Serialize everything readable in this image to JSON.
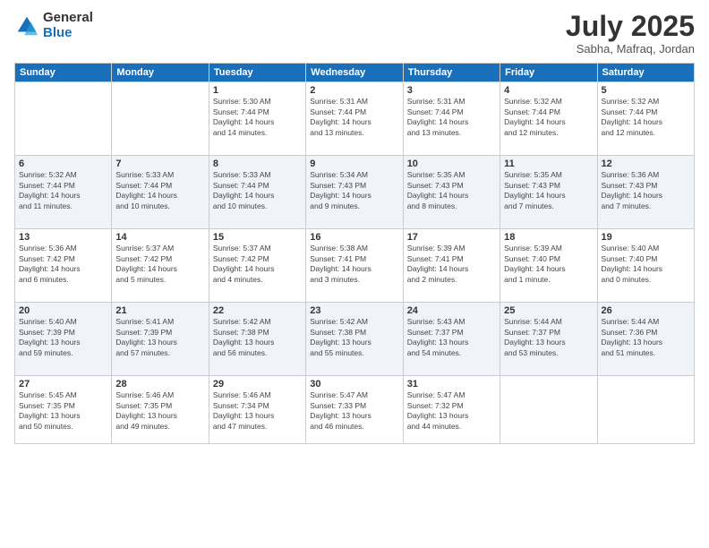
{
  "logo": {
    "general": "General",
    "blue": "Blue"
  },
  "title": "July 2025",
  "subtitle": "Sabha, Mafraq, Jordan",
  "days_of_week": [
    "Sunday",
    "Monday",
    "Tuesday",
    "Wednesday",
    "Thursday",
    "Friday",
    "Saturday"
  ],
  "weeks": [
    [
      {
        "num": "",
        "info": ""
      },
      {
        "num": "",
        "info": ""
      },
      {
        "num": "1",
        "info": "Sunrise: 5:30 AM\nSunset: 7:44 PM\nDaylight: 14 hours\nand 14 minutes."
      },
      {
        "num": "2",
        "info": "Sunrise: 5:31 AM\nSunset: 7:44 PM\nDaylight: 14 hours\nand 13 minutes."
      },
      {
        "num": "3",
        "info": "Sunrise: 5:31 AM\nSunset: 7:44 PM\nDaylight: 14 hours\nand 13 minutes."
      },
      {
        "num": "4",
        "info": "Sunrise: 5:32 AM\nSunset: 7:44 PM\nDaylight: 14 hours\nand 12 minutes."
      },
      {
        "num": "5",
        "info": "Sunrise: 5:32 AM\nSunset: 7:44 PM\nDaylight: 14 hours\nand 12 minutes."
      }
    ],
    [
      {
        "num": "6",
        "info": "Sunrise: 5:32 AM\nSunset: 7:44 PM\nDaylight: 14 hours\nand 11 minutes."
      },
      {
        "num": "7",
        "info": "Sunrise: 5:33 AM\nSunset: 7:44 PM\nDaylight: 14 hours\nand 10 minutes."
      },
      {
        "num": "8",
        "info": "Sunrise: 5:33 AM\nSunset: 7:44 PM\nDaylight: 14 hours\nand 10 minutes."
      },
      {
        "num": "9",
        "info": "Sunrise: 5:34 AM\nSunset: 7:43 PM\nDaylight: 14 hours\nand 9 minutes."
      },
      {
        "num": "10",
        "info": "Sunrise: 5:35 AM\nSunset: 7:43 PM\nDaylight: 14 hours\nand 8 minutes."
      },
      {
        "num": "11",
        "info": "Sunrise: 5:35 AM\nSunset: 7:43 PM\nDaylight: 14 hours\nand 7 minutes."
      },
      {
        "num": "12",
        "info": "Sunrise: 5:36 AM\nSunset: 7:43 PM\nDaylight: 14 hours\nand 7 minutes."
      }
    ],
    [
      {
        "num": "13",
        "info": "Sunrise: 5:36 AM\nSunset: 7:42 PM\nDaylight: 14 hours\nand 6 minutes."
      },
      {
        "num": "14",
        "info": "Sunrise: 5:37 AM\nSunset: 7:42 PM\nDaylight: 14 hours\nand 5 minutes."
      },
      {
        "num": "15",
        "info": "Sunrise: 5:37 AM\nSunset: 7:42 PM\nDaylight: 14 hours\nand 4 minutes."
      },
      {
        "num": "16",
        "info": "Sunrise: 5:38 AM\nSunset: 7:41 PM\nDaylight: 14 hours\nand 3 minutes."
      },
      {
        "num": "17",
        "info": "Sunrise: 5:39 AM\nSunset: 7:41 PM\nDaylight: 14 hours\nand 2 minutes."
      },
      {
        "num": "18",
        "info": "Sunrise: 5:39 AM\nSunset: 7:40 PM\nDaylight: 14 hours\nand 1 minute."
      },
      {
        "num": "19",
        "info": "Sunrise: 5:40 AM\nSunset: 7:40 PM\nDaylight: 14 hours\nand 0 minutes."
      }
    ],
    [
      {
        "num": "20",
        "info": "Sunrise: 5:40 AM\nSunset: 7:39 PM\nDaylight: 13 hours\nand 59 minutes."
      },
      {
        "num": "21",
        "info": "Sunrise: 5:41 AM\nSunset: 7:39 PM\nDaylight: 13 hours\nand 57 minutes."
      },
      {
        "num": "22",
        "info": "Sunrise: 5:42 AM\nSunset: 7:38 PM\nDaylight: 13 hours\nand 56 minutes."
      },
      {
        "num": "23",
        "info": "Sunrise: 5:42 AM\nSunset: 7:38 PM\nDaylight: 13 hours\nand 55 minutes."
      },
      {
        "num": "24",
        "info": "Sunrise: 5:43 AM\nSunset: 7:37 PM\nDaylight: 13 hours\nand 54 minutes."
      },
      {
        "num": "25",
        "info": "Sunrise: 5:44 AM\nSunset: 7:37 PM\nDaylight: 13 hours\nand 53 minutes."
      },
      {
        "num": "26",
        "info": "Sunrise: 5:44 AM\nSunset: 7:36 PM\nDaylight: 13 hours\nand 51 minutes."
      }
    ],
    [
      {
        "num": "27",
        "info": "Sunrise: 5:45 AM\nSunset: 7:35 PM\nDaylight: 13 hours\nand 50 minutes."
      },
      {
        "num": "28",
        "info": "Sunrise: 5:46 AM\nSunset: 7:35 PM\nDaylight: 13 hours\nand 49 minutes."
      },
      {
        "num": "29",
        "info": "Sunrise: 5:46 AM\nSunset: 7:34 PM\nDaylight: 13 hours\nand 47 minutes."
      },
      {
        "num": "30",
        "info": "Sunrise: 5:47 AM\nSunset: 7:33 PM\nDaylight: 13 hours\nand 46 minutes."
      },
      {
        "num": "31",
        "info": "Sunrise: 5:47 AM\nSunset: 7:32 PM\nDaylight: 13 hours\nand 44 minutes."
      },
      {
        "num": "",
        "info": ""
      },
      {
        "num": "",
        "info": ""
      }
    ]
  ]
}
